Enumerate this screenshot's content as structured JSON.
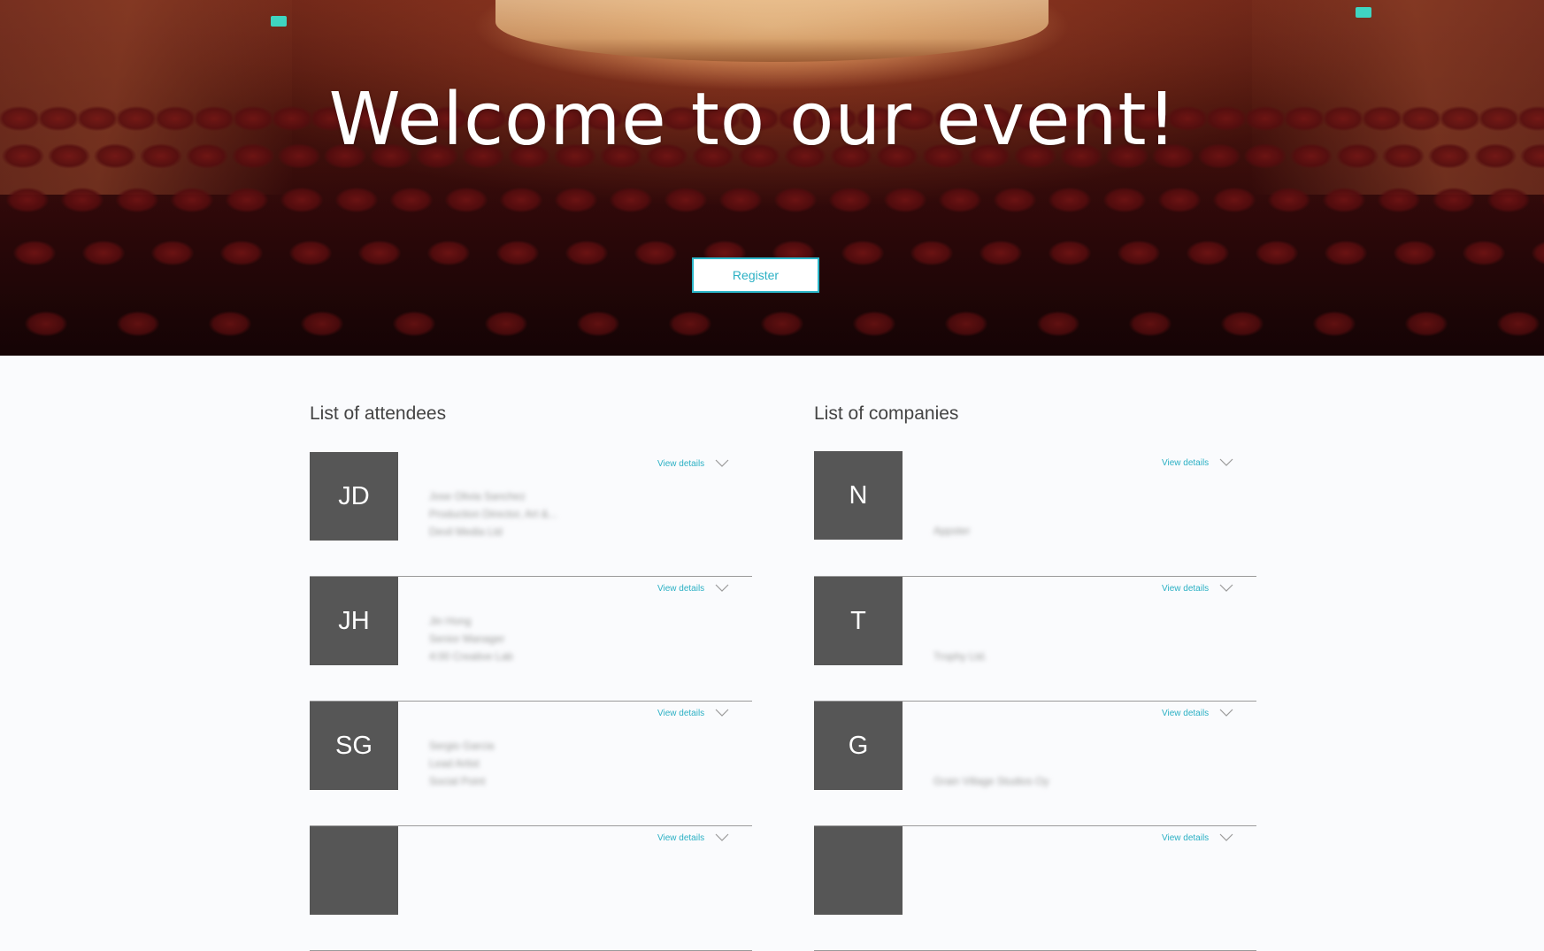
{
  "hero": {
    "title": "Welcome to our event!",
    "register_label": "Register"
  },
  "attendees": {
    "title": "List of attendees",
    "items": [
      {
        "initials": "JD",
        "details_label": "View details",
        "name": "Jose Olivia Sanchez",
        "role": "Production Director, Art &...",
        "company": "Devil Media Ltd"
      },
      {
        "initials": "JH",
        "details_label": "View details",
        "name": "Jin Hong",
        "role": "Senior Manager",
        "company": "4:00 Creative Lab"
      },
      {
        "initials": "SG",
        "details_label": "View details",
        "name": "Sergio Garcia",
        "role": "Lead Artist",
        "company": "Social Point"
      },
      {
        "initials": "",
        "details_label": "View details",
        "name": "",
        "role": "",
        "company": ""
      }
    ]
  },
  "companies": {
    "title": "List of companies",
    "items": [
      {
        "initials": "N",
        "details_label": "View details",
        "name": "Appster"
      },
      {
        "initials": "T",
        "details_label": "View details",
        "name": "Trophy Ltd."
      },
      {
        "initials": "G",
        "details_label": "View details",
        "name": "Grain Village Studios Oy"
      },
      {
        "initials": "",
        "details_label": "View details",
        "name": ""
      }
    ]
  },
  "colors": {
    "accent": "#2bb0c4",
    "avatar_bg": "#565656",
    "page_bg": "#fafbfd"
  },
  "icons": {
    "expand": "chevron-down-icon"
  }
}
